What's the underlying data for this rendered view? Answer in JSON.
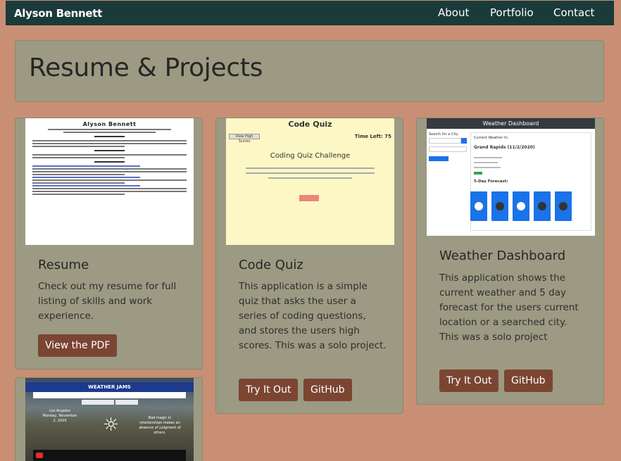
{
  "nav": {
    "brand": "Alyson Bennett",
    "links": [
      "About",
      "Portfolio",
      "Contact"
    ]
  },
  "header": {
    "title": "Resume & Projects"
  },
  "cards": [
    {
      "title": "Resume",
      "text": "Check out my resume for full listing of skills and work experience.",
      "buttons": [
        "View the PDF"
      ],
      "thumb": {
        "name": "Alyson Bennett"
      }
    },
    {
      "title": "Code Quiz",
      "text": "This application is a simple quiz that asks the user a series of coding questions, and stores the users high scores. This was a solo project.",
      "buttons": [
        "Try It Out",
        "GitHub"
      ],
      "thumb": {
        "title": "Code Quiz",
        "highscores": "View High Scores",
        "timer": "Time Left: 75",
        "heading": "Coding Quiz Challenge"
      }
    },
    {
      "title": "Weather Dashboard",
      "text": "This application shows the current weather and 5 day forecast for the users current location or a searched city. This was a solo project",
      "buttons": [
        "Try It Out",
        "GitHub"
      ],
      "thumb": {
        "title": "Weather Dashboard",
        "search_label": "Search for a City",
        "current_label": "Current Weather In:",
        "city": "Grand Rapids (11/2/2020)",
        "forecast_label": "5-Day Forecast:"
      }
    },
    {
      "title": "",
      "text": "",
      "buttons": [],
      "thumb": {
        "title": "WEATHER JAMS",
        "location": "Los Angeles",
        "date": "Monday, November 2, 2020",
        "quote": "Bad magic in relationships makes an absence of judgment of others."
      }
    }
  ],
  "colors": {
    "background": "#c98f74",
    "navbar": "#1a3b39",
    "card": "#9c9a82",
    "button": "#7b4532"
  }
}
